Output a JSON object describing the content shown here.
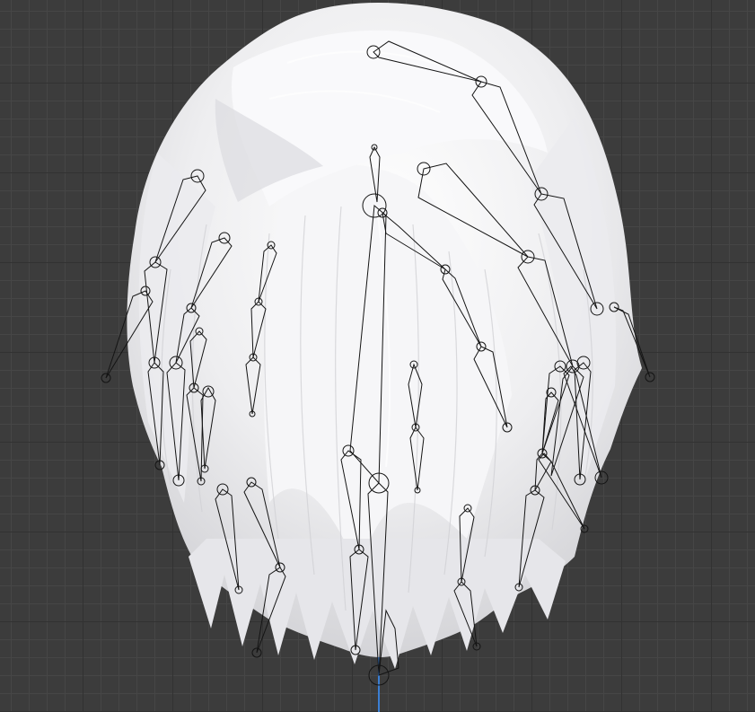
{
  "viewport": {
    "background": "#3c3c3c",
    "grid_minor": "#464646",
    "grid_major": "#323232",
    "axis_color": "#3b7fd4"
  },
  "model": {
    "hair_color": "#f2f2f2",
    "hair_shadow": "#c9c9cd",
    "bone_color": "#141414",
    "bone_chain_count": 18
  }
}
